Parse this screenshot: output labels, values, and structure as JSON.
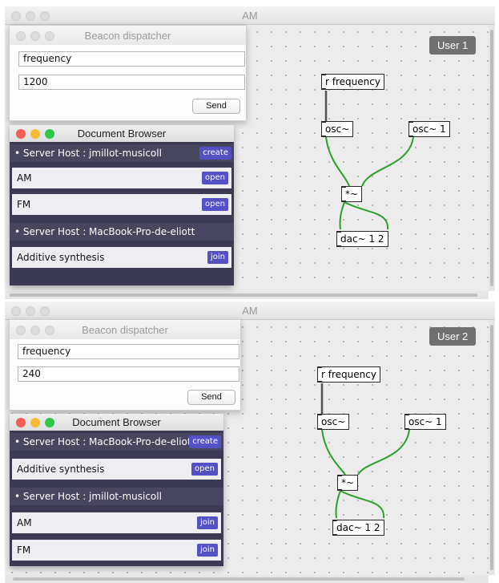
{
  "windows": [
    {
      "title": "AM",
      "user_label": "User 1",
      "patch": {
        "receive": "r frequency",
        "osc_left": "osc~",
        "osc_right": "osc~ 1",
        "multiply": "*~",
        "dac": "dac~ 1 2"
      },
      "beacon": {
        "title": "Beacon dispatcher",
        "field1": "frequency",
        "field2": "1200",
        "send_label": "Send"
      },
      "browser": {
        "title": "Document Browser",
        "host1": {
          "label": "• Server Host : jmillot-musicoll",
          "action": "create"
        },
        "docs1": [
          {
            "name": "AM",
            "action": "open"
          },
          {
            "name": "FM",
            "action": "open"
          }
        ],
        "host2": {
          "label": "• Server Host : MacBook-Pro-de-eliott"
        },
        "docs2": [
          {
            "name": "Additive synthesis",
            "action": "join"
          }
        ]
      }
    },
    {
      "title": "AM",
      "user_label": "User 2",
      "patch": {
        "receive": "r frequency",
        "osc_left": "osc~",
        "osc_right": "osc~ 1",
        "multiply": "*~",
        "dac": "dac~ 1 2"
      },
      "beacon": {
        "title": "Beacon dispatcher",
        "field1": "frequency",
        "field2": "240",
        "send_label": "Send"
      },
      "browser": {
        "title": "Document Browser",
        "host1": {
          "label": "• Server Host : MacBook-Pro-de-eliott",
          "action": "create"
        },
        "docs1": [
          {
            "name": "Additive synthesis",
            "action": "open"
          }
        ],
        "host2": {
          "label": "• Server Host : jmillot-musicoll"
        },
        "docs2": [
          {
            "name": "AM",
            "action": "join"
          },
          {
            "name": "FM",
            "action": "join"
          }
        ]
      }
    }
  ],
  "colors": {
    "cable_signal": "#2ca02c",
    "cable_control": "#555555",
    "browser_bg": "#3c3a52",
    "action_button": "#5451c4"
  }
}
